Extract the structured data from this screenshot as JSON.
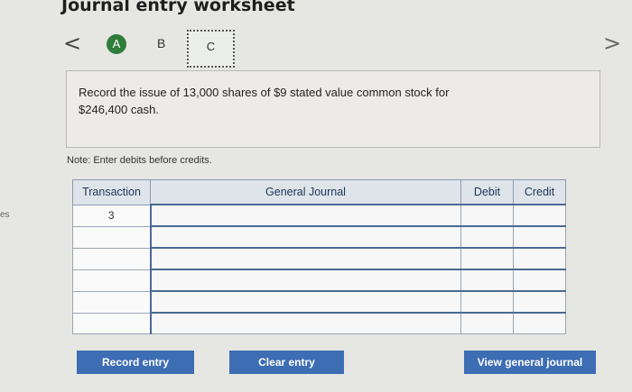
{
  "header": {
    "title": "Journal entry worksheet",
    "side_fragment": "es"
  },
  "nav": {
    "prev_glyph": "<",
    "next_glyph": ">"
  },
  "tabs": [
    {
      "label": "A"
    },
    {
      "label": "B"
    },
    {
      "label": "C"
    }
  ],
  "prompt": {
    "line1": "Record the issue of 13,000 shares of $9 stated value common stock for",
    "line2": "$246,400 cash."
  },
  "note": "Note: Enter debits before credits.",
  "table": {
    "headers": [
      "Transaction",
      "General Journal",
      "Debit",
      "Credit"
    ],
    "rows": [
      {
        "transaction": "3",
        "account": "",
        "debit": "",
        "credit": ""
      },
      {
        "transaction": "",
        "account": "",
        "debit": "",
        "credit": ""
      },
      {
        "transaction": "",
        "account": "",
        "debit": "",
        "credit": ""
      },
      {
        "transaction": "",
        "account": "",
        "debit": "",
        "credit": ""
      },
      {
        "transaction": "",
        "account": "",
        "debit": "",
        "credit": ""
      },
      {
        "transaction": "",
        "account": "",
        "debit": "",
        "credit": ""
      }
    ]
  },
  "buttons": {
    "record": "Record entry",
    "clear": "Clear entry",
    "view": "View general journal"
  },
  "colors": {
    "tab_active": "#2f7d3b",
    "button": "#3d6db3",
    "header_bg": "#dfe4ea"
  }
}
